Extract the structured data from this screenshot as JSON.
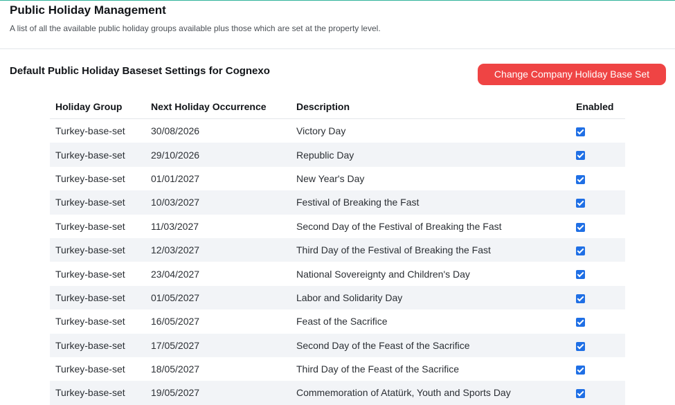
{
  "header": {
    "title": "Public Holiday Management",
    "subtitle": "A list of all the available public holiday groups available plus those which are set at the property level."
  },
  "section": {
    "title": "Default Public Holiday Baseset Settings for Cognexo",
    "change_button_label": "Change Company Holiday Base Set"
  },
  "colors": {
    "accent_line": "#2fb39a",
    "button_bg": "#ef4444",
    "checkbox": "#1f6fe5",
    "row_stripe": "#f2f4f7"
  },
  "table": {
    "columns": [
      "Holiday Group",
      "Next Holiday Occurrence",
      "Description",
      "Enabled"
    ],
    "rows": [
      {
        "group": "Turkey-base-set",
        "date": "30/08/2026",
        "description": "Victory Day",
        "enabled": true
      },
      {
        "group": "Turkey-base-set",
        "date": "29/10/2026",
        "description": "Republic Day",
        "enabled": true
      },
      {
        "group": "Turkey-base-set",
        "date": "01/01/2027",
        "description": "New Year's Day",
        "enabled": true
      },
      {
        "group": "Turkey-base-set",
        "date": "10/03/2027",
        "description": "Festival of Breaking the Fast",
        "enabled": true
      },
      {
        "group": "Turkey-base-set",
        "date": "11/03/2027",
        "description": "Second Day of the Festival of Breaking the Fast",
        "enabled": true
      },
      {
        "group": "Turkey-base-set",
        "date": "12/03/2027",
        "description": "Third Day of the Festival of Breaking the Fast",
        "enabled": true
      },
      {
        "group": "Turkey-base-set",
        "date": "23/04/2027",
        "description": "National Sovereignty and Children's Day",
        "enabled": true
      },
      {
        "group": "Turkey-base-set",
        "date": "01/05/2027",
        "description": "Labor and Solidarity Day",
        "enabled": true
      },
      {
        "group": "Turkey-base-set",
        "date": "16/05/2027",
        "description": "Feast of the Sacrifice",
        "enabled": true
      },
      {
        "group": "Turkey-base-set",
        "date": "17/05/2027",
        "description": "Second Day of the Feast of the Sacrifice",
        "enabled": true
      },
      {
        "group": "Turkey-base-set",
        "date": "18/05/2027",
        "description": "Third Day of the Feast of the Sacrifice",
        "enabled": true
      },
      {
        "group": "Turkey-base-set",
        "date": "19/05/2027",
        "description": "Commemoration of Atatürk, Youth and Sports Day",
        "enabled": true
      }
    ]
  }
}
